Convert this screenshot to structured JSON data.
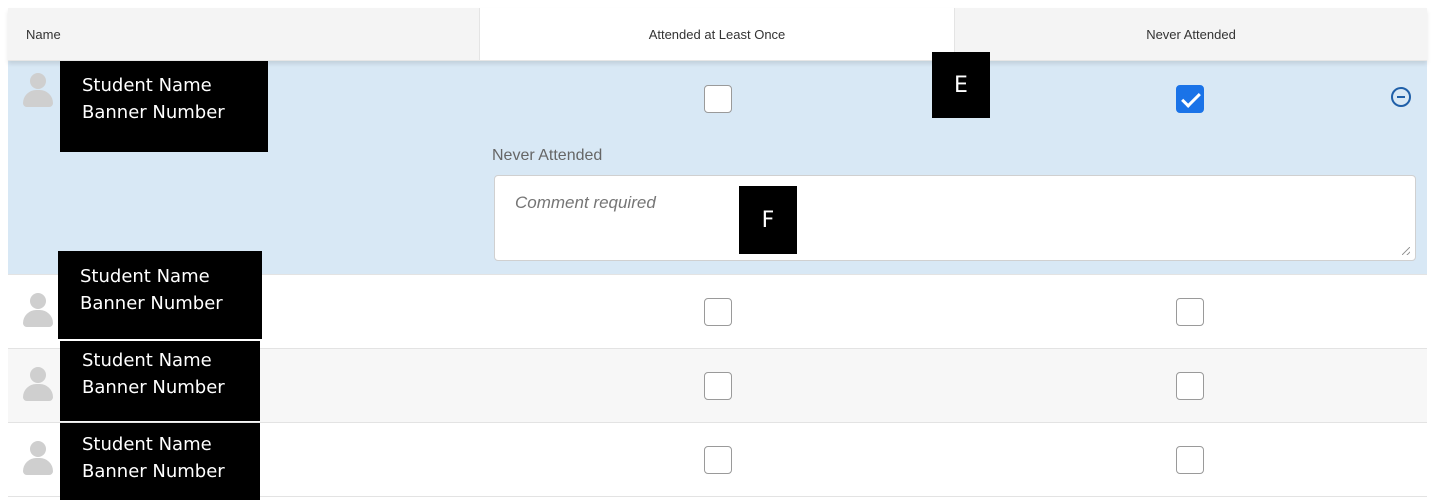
{
  "table": {
    "headers": {
      "name": "Name",
      "attended": "Attended at Least Once",
      "never": "Never Attended"
    }
  },
  "rows": [
    {
      "student_name": "Student Name",
      "banner_number": "Banner Number",
      "attended_checked": false,
      "never_checked": true,
      "expanded": true,
      "comment_label": "Never Attended",
      "comment_placeholder": "Comment required",
      "comment_value": ""
    },
    {
      "student_name": "Student Name",
      "banner_number": "Banner Number",
      "attended_checked": false,
      "never_checked": false,
      "expanded": false
    },
    {
      "student_name": "Student Name",
      "banner_number": "Banner Number",
      "attended_checked": false,
      "never_checked": false,
      "expanded": false
    },
    {
      "student_name": "Student Name",
      "banner_number": "Banner Number",
      "attended_checked": false,
      "never_checked": false,
      "expanded": false
    }
  ],
  "markers": {
    "e": "E",
    "f": "F"
  },
  "icons": {
    "avatar": "user-avatar-icon",
    "collapse": "minus-circle-icon",
    "check": "checkmark-icon"
  },
  "colors": {
    "expanded_row_bg": "#d8e8f5",
    "checkbox_checked": "#1a73e8",
    "collapse_icon": "#1f5fa8"
  }
}
